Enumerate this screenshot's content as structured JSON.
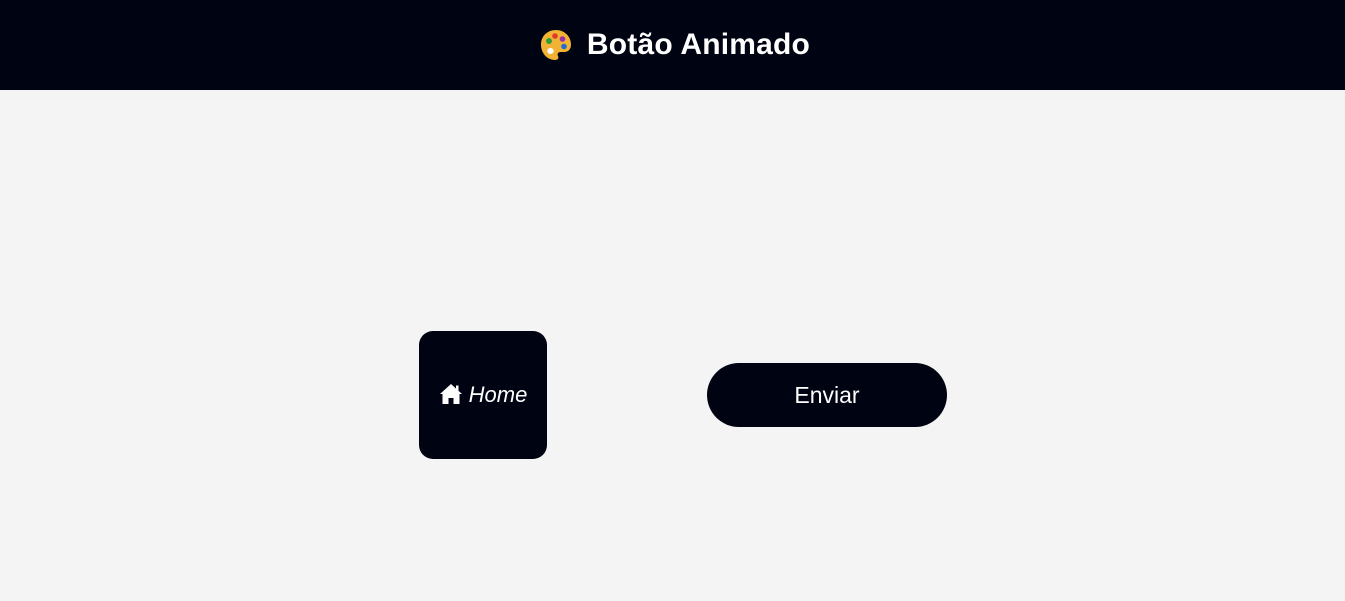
{
  "header": {
    "icon": "palette-icon",
    "title": "Botão Animado"
  },
  "buttons": {
    "home": {
      "icon": "house-icon",
      "label": "Home"
    },
    "send": {
      "label": "Enviar"
    }
  },
  "colors": {
    "header_bg": "#000311",
    "page_bg": "#f4f4f4",
    "button_bg": "#000311",
    "text": "#ffffff"
  }
}
